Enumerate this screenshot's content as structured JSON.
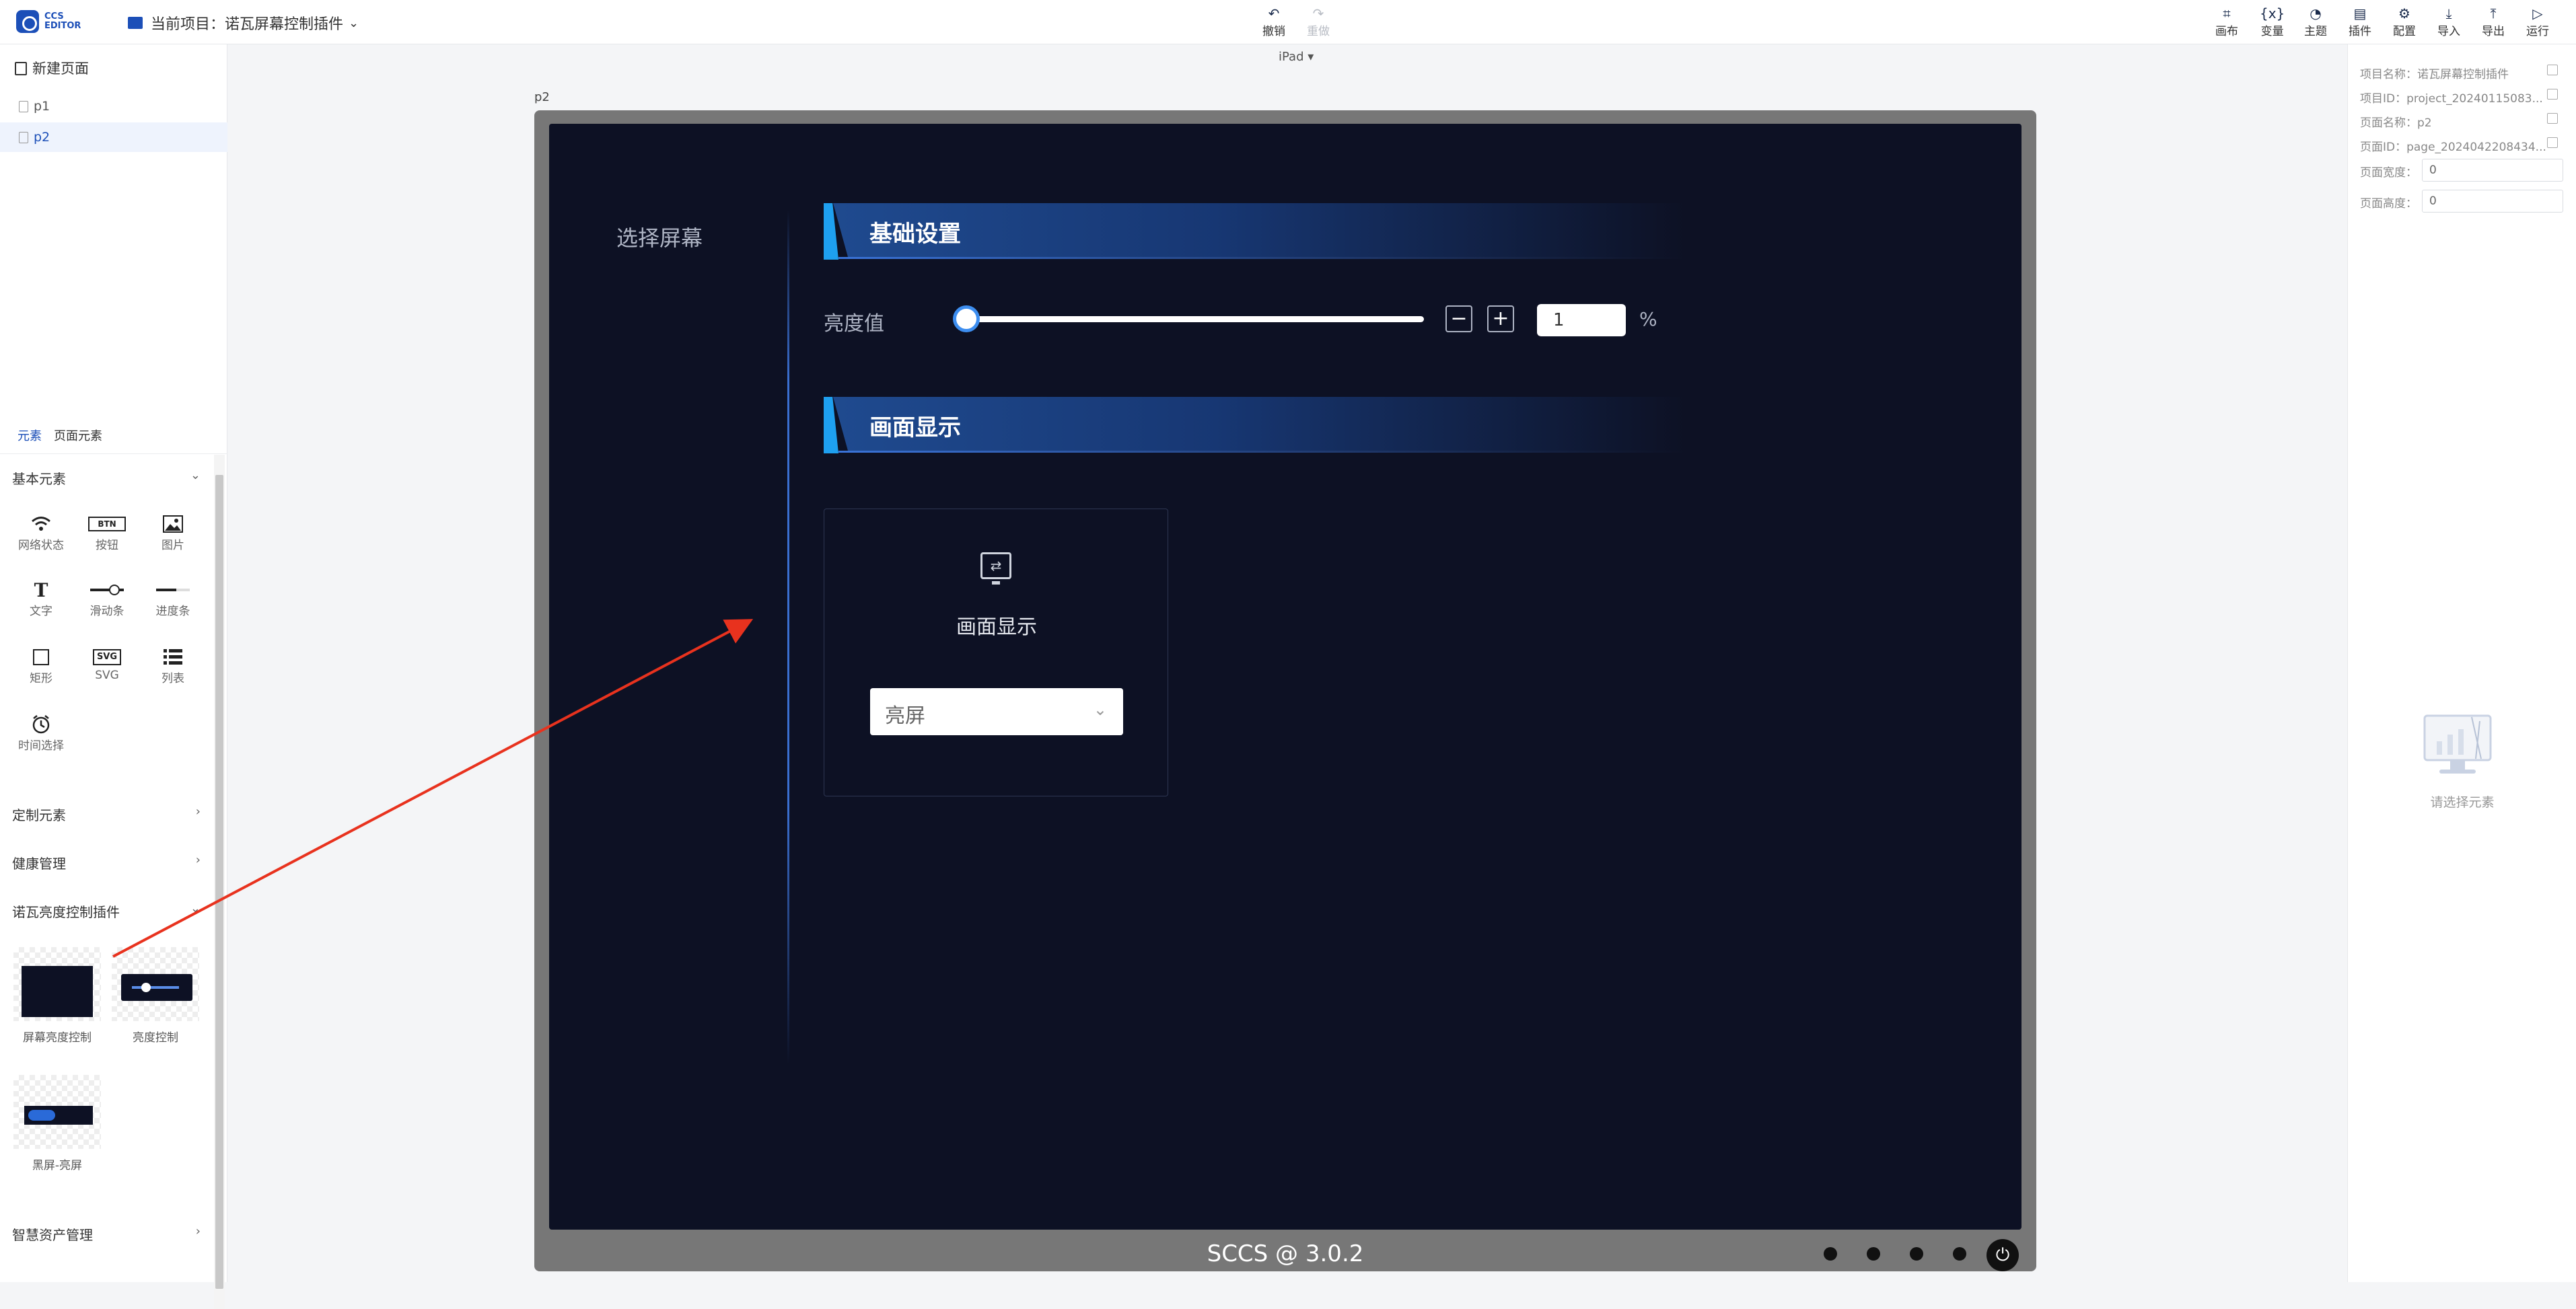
{
  "app": {
    "logo_line1": "CCS",
    "logo_line2": "EDITOR"
  },
  "project": {
    "label": "当前项目：诺瓦屏幕控制插件"
  },
  "toolbar": {
    "undo": "撤销",
    "redo": "重做",
    "canvas": "画布",
    "variables": "变量",
    "theme": "主题",
    "plugins": "插件",
    "config": "配置",
    "import": "导入",
    "export": "导出",
    "run": "运行"
  },
  "left": {
    "new_page": "新建页面",
    "pages": [
      "p1",
      "p2"
    ],
    "tabs": [
      "元素",
      "页面元素"
    ],
    "groups": {
      "basic": "基本元素",
      "custom": "定制元素",
      "health": "健康管理",
      "nova": "诺瓦亮度控制插件",
      "assets": "智慧资产管理"
    },
    "basic_items": {
      "network": "网络状态",
      "button": "按钮",
      "image": "图片",
      "text": "文字",
      "slider": "滑动条",
      "progress": "进度条",
      "rect": "矩形",
      "svg": "SVG",
      "list": "列表",
      "time": "时间选择"
    },
    "button_glyph": "BTN",
    "svg_glyph": "SVG",
    "plugins": [
      "屏幕亮度控制",
      "亮度控制",
      "黑屏-亮屏"
    ]
  },
  "canvas": {
    "device": "iPad",
    "page_tag": "p2",
    "select_screen": "选择屏幕",
    "section_basic": "基础设置",
    "brightness_label": "亮度值",
    "brightness_value": 0.0,
    "brightness_input": "1",
    "percent": "%",
    "minus": "−",
    "plus": "+",
    "section_display": "画面显示",
    "display_card_title": "画面显示",
    "display_select": "亮屏",
    "footer": "SCCS @ 3.0.2"
  },
  "right": {
    "project_name": "项目名称：诺瓦屏幕控制插件",
    "project_id": "项目ID：project_20240115083...",
    "page_name": "页面名称：p2",
    "page_id": "页面ID：page_2024042208434...",
    "page_width_label": "页面宽度：",
    "page_width": "0",
    "page_height_label": "页面高度：",
    "page_height": "0",
    "empty": "请选择元素"
  },
  "colors": {
    "accent": "#1c4fb8",
    "screen_bg": "#0d1124",
    "section_accent": "#1ea0f0",
    "annotation_arrow": "#e8321e"
  }
}
